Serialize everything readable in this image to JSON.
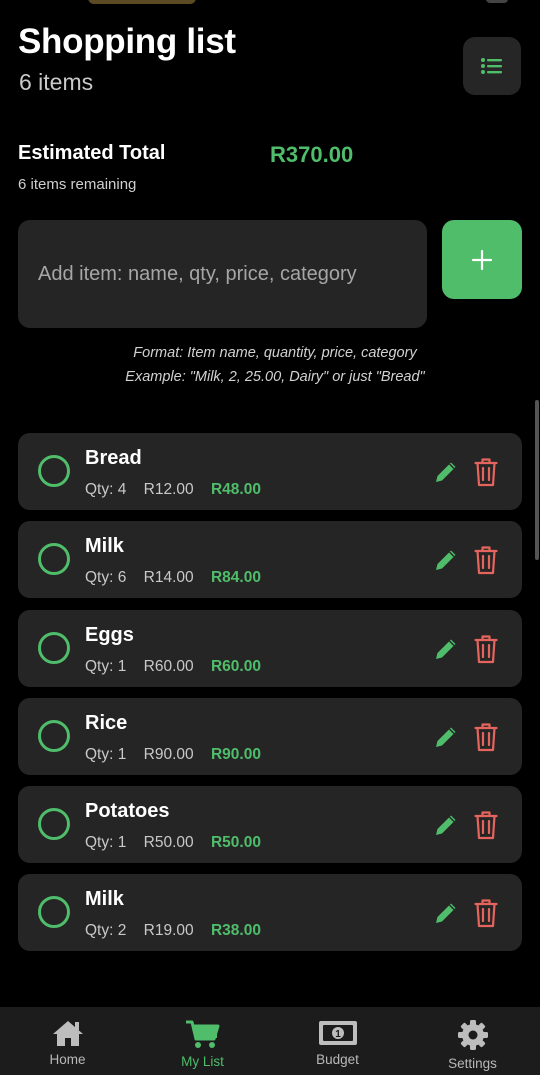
{
  "header": {
    "title": "Shopping list",
    "subtitle": "6 items"
  },
  "summary": {
    "estimated_label": "Estimated Total",
    "estimated_value": "R370.00",
    "remaining": "6 items remaining"
  },
  "add_item": {
    "placeholder": "Add item: name, qty, price, category",
    "hint_line1": "Format: Item name, quantity, price, category",
    "hint_line2": "Example: \"Milk, 2, 25.00, Dairy\" or just \"Bread\""
  },
  "items": [
    {
      "name": "Bread",
      "qty": "Qty: 4",
      "price": "R12.00",
      "total": "R48.00"
    },
    {
      "name": "Milk",
      "qty": "Qty: 6",
      "price": "R14.00",
      "total": "R84.00"
    },
    {
      "name": "Eggs",
      "qty": "Qty: 1",
      "price": "R60.00",
      "total": "R60.00"
    },
    {
      "name": "Rice",
      "qty": "Qty: 1",
      "price": "R90.00",
      "total": "R90.00"
    },
    {
      "name": "Potatoes",
      "qty": "Qty: 1",
      "price": "R50.00",
      "total": "R50.00"
    },
    {
      "name": "Milk",
      "qty": "Qty: 2",
      "price": "R19.00",
      "total": "R38.00"
    }
  ],
  "tabs": [
    {
      "label": "Home",
      "icon": "home-icon"
    },
    {
      "label": "My List",
      "icon": "cart-icon",
      "active": true
    },
    {
      "label": "Budget",
      "icon": "money-icon"
    },
    {
      "label": "Settings",
      "icon": "gear-icon"
    }
  ],
  "colors": {
    "accent": "#4fbd6a",
    "delete": "#e5645d",
    "background": "#000000",
    "card": "#252525"
  }
}
